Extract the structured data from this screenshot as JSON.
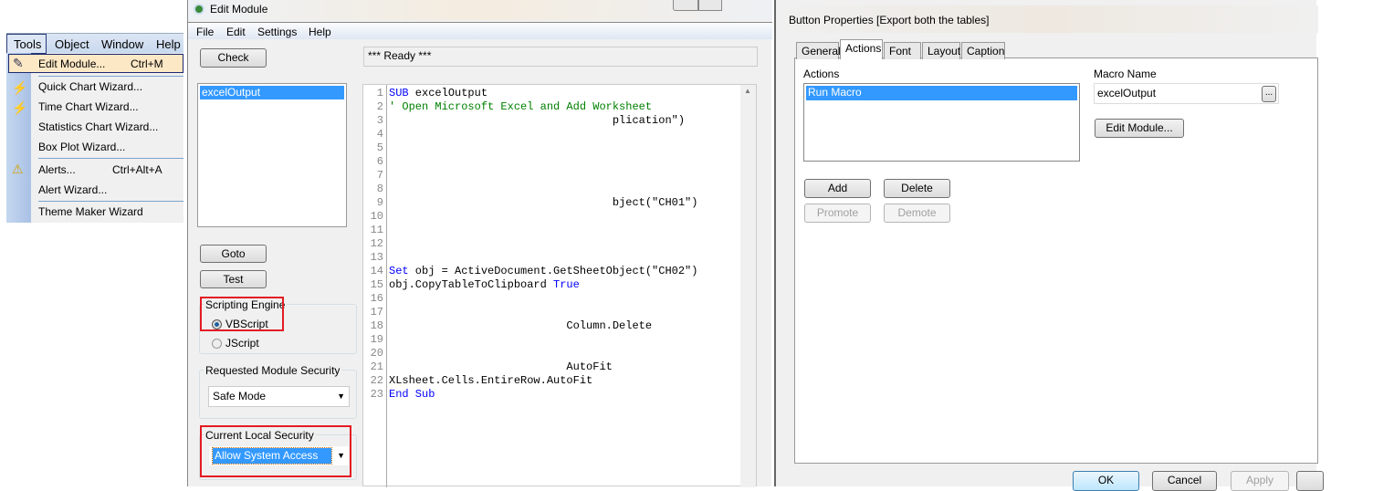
{
  "tools_menu": {
    "menubar": [
      "Tools",
      "Object",
      "Window",
      "Help"
    ],
    "items": [
      {
        "label": "Edit Module...",
        "shortcut": "Ctrl+M",
        "icon": "edit-module-icon",
        "highlighted": true
      },
      {
        "label": "Quick Chart Wizard...",
        "icon": "quick-chart-icon"
      },
      {
        "label": "Time Chart Wizard...",
        "icon": "time-chart-icon"
      },
      {
        "label": "Statistics Chart Wizard..."
      },
      {
        "label": "Box Plot Wizard..."
      },
      {
        "label": "Alerts...",
        "shortcut": "Ctrl+Alt+A",
        "icon": "alert-icon"
      },
      {
        "label": "Alert Wizard..."
      },
      {
        "label": "Theme Maker Wizard"
      }
    ]
  },
  "edit_module": {
    "title": "Edit Module",
    "menu": [
      "File",
      "Edit",
      "Settings",
      "Help"
    ],
    "check_label": "Check",
    "status": "*** Ready ***",
    "modules": [
      "excelOutput"
    ],
    "goto_label": "Goto",
    "test_label": "Test",
    "scripting_engine": {
      "label": "Scripting Engine",
      "options": [
        "VBScript",
        "JScript"
      ],
      "selected": "VBScript"
    },
    "requested_security": {
      "label": "Requested Module Security",
      "value": "Safe Mode"
    },
    "current_security": {
      "label": "Current Local Security",
      "value": "Allow System Access"
    },
    "code_lines": [
      {
        "n": "1",
        "text": "SUB excelOutput"
      },
      {
        "n": "2",
        "text": "' Open Microsoft Excel and Add Worksheet"
      },
      {
        "n": "3",
        "text": "                                  plication\")"
      },
      {
        "n": "4",
        "text": ""
      },
      {
        "n": "5",
        "text": ""
      },
      {
        "n": "6",
        "text": ""
      },
      {
        "n": "7",
        "text": ""
      },
      {
        "n": "8",
        "text": ""
      },
      {
        "n": "9",
        "text": "                                  bject(\"CH01\")"
      },
      {
        "n": "10",
        "text": ""
      },
      {
        "n": "11",
        "text": ""
      },
      {
        "n": "12",
        "text": ""
      },
      {
        "n": "13",
        "text": ""
      },
      {
        "n": "14",
        "text": "Set obj = ActiveDocument.GetSheetObject(\"CH02\")"
      },
      {
        "n": "15",
        "text": "obj.CopyTableToClipboard True"
      },
      {
        "n": "16",
        "text": ""
      },
      {
        "n": "17",
        "text": ""
      },
      {
        "n": "18",
        "text": "                           Column.Delete"
      },
      {
        "n": "19",
        "text": ""
      },
      {
        "n": "20",
        "text": ""
      },
      {
        "n": "21",
        "text": "                           AutoFit"
      },
      {
        "n": "22",
        "text": "XLsheet.Cells.EntireRow.AutoFit"
      },
      {
        "n": "23",
        "text": "End Sub"
      }
    ]
  },
  "button_properties": {
    "title": "Button Properties [Export both the tables]",
    "tabs": [
      "General",
      "Actions",
      "Font",
      "Layout",
      "Caption"
    ],
    "active_tab": "Actions",
    "actions_label": "Actions",
    "actions": [
      "Run Macro"
    ],
    "macro_name_label": "Macro Name",
    "macro_name": "excelOutput",
    "browse_label": "...",
    "edit_module_label": "Edit Module...",
    "add_label": "Add",
    "delete_label": "Delete",
    "promote_label": "Promote",
    "demote_label": "Demote",
    "ok_label": "OK",
    "cancel_label": "Cancel",
    "apply_label": "Apply"
  },
  "colors": {
    "selection": "#3399ff",
    "highlight_box": "#e41b23",
    "keyword": "#0000ff",
    "comment": "#008000"
  }
}
